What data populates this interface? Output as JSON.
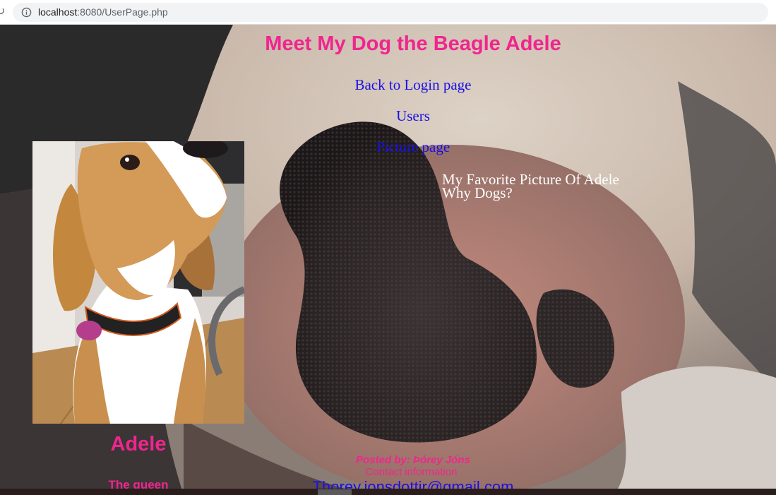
{
  "browser": {
    "url_host": "localhost",
    "url_rest": ":8080/UserPage.php"
  },
  "page": {
    "title": "Meet My Dog the Beagle Adele",
    "nav": {
      "login": "Back to Login page",
      "users": "Users",
      "picture": "Picture page"
    },
    "favorite_heading": "My Favorite Picture Of Adele",
    "why_dogs": "Why Dogs?",
    "profile": {
      "name": "Adele",
      "subtitle": "The queen"
    },
    "footer": {
      "posted_by": "Posted by: Þórey Jóns",
      "contact_label": "Contact information",
      "email": "Thorey.jonsdottir@gmail.com"
    }
  },
  "colors": {
    "accent": "#f0258e",
    "link": "#1a10e6",
    "text_light": "#ffffff"
  }
}
